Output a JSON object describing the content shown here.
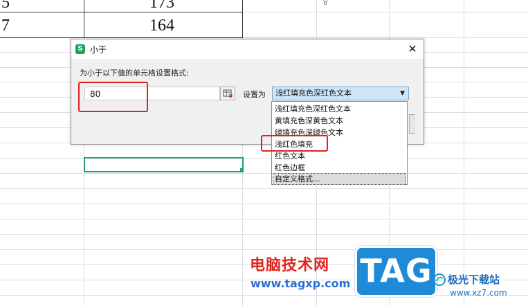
{
  "sheet": {
    "rows": [
      {
        "col_a": "5",
        "col_b": "173"
      },
      {
        "col_a": "7",
        "col_b": "164"
      }
    ],
    "colors": {
      "grid": "#d9dfe3",
      "selection": "#23a066"
    }
  },
  "dialog": {
    "app_icon": "S",
    "title": "小于",
    "close_glyph": "✕",
    "prompt": "为小于以下值的单元格设置格式:",
    "value": "80",
    "set_label": "设置为",
    "selected_format": "浅红填充色深红色文本",
    "arrow_glyph": "▼"
  },
  "dropdown": {
    "options": [
      "浅红填充色深红色文本",
      "黄填充色深黄色文本",
      "绿填充色深绿色文本",
      "浅红色填充",
      "红色文本",
      "红色边框",
      "自定义格式..."
    ],
    "highlighted_index": 6
  },
  "watermark": {
    "site_cn": "电脑技术网",
    "site_url": "www.tagxp.com",
    "badge": "TAG",
    "brand": "极光下载站",
    "brand_url": "www.xz7.com"
  },
  "annotation_color": "#e02020",
  "icons": {
    "ref_button": "range-select-icon",
    "app": "wps-spreadsheet-icon"
  }
}
